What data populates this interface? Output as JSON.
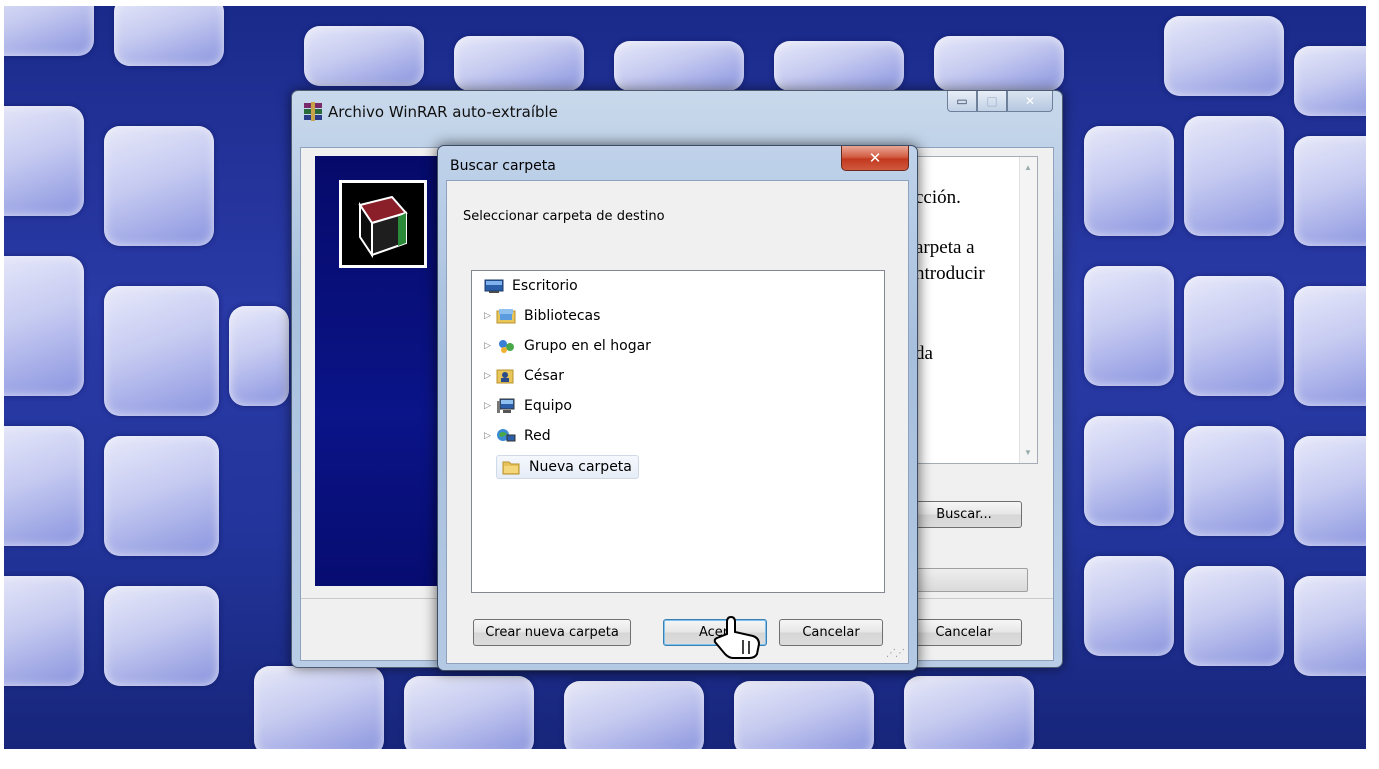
{
  "winrar": {
    "title": "Archivo WinRAR auto-extraíble",
    "text_lines": [
      "cción.",
      "arpeta a",
      "ntroducir",
      "da"
    ],
    "browse_button": "Buscar...",
    "cancel_button": "Cancelar"
  },
  "dialog": {
    "title": "Buscar carpeta",
    "prompt": "Seleccionar carpeta de destino",
    "tree": [
      {
        "label": "Escritorio",
        "icon": "desktop-icon",
        "expandable": false
      },
      {
        "label": "Bibliotecas",
        "icon": "libraries-icon",
        "expandable": true
      },
      {
        "label": "Grupo en el hogar",
        "icon": "homegroup-icon",
        "expandable": true
      },
      {
        "label": "César",
        "icon": "user-folder-icon",
        "expandable": true
      },
      {
        "label": "Equipo",
        "icon": "computer-icon",
        "expandable": true
      },
      {
        "label": "Red",
        "icon": "network-icon",
        "expandable": true
      },
      {
        "label": "Nueva carpeta",
        "icon": "folder-icon",
        "expandable": false,
        "selected": true
      }
    ],
    "buttons": {
      "new_folder": "Crear nueva carpeta",
      "ok": "Acep",
      "cancel": "Cancelar"
    }
  },
  "colors": {
    "desktop_blue": "#23359c",
    "titlebar": "#b9cde6",
    "close_red": "#c7452d"
  }
}
